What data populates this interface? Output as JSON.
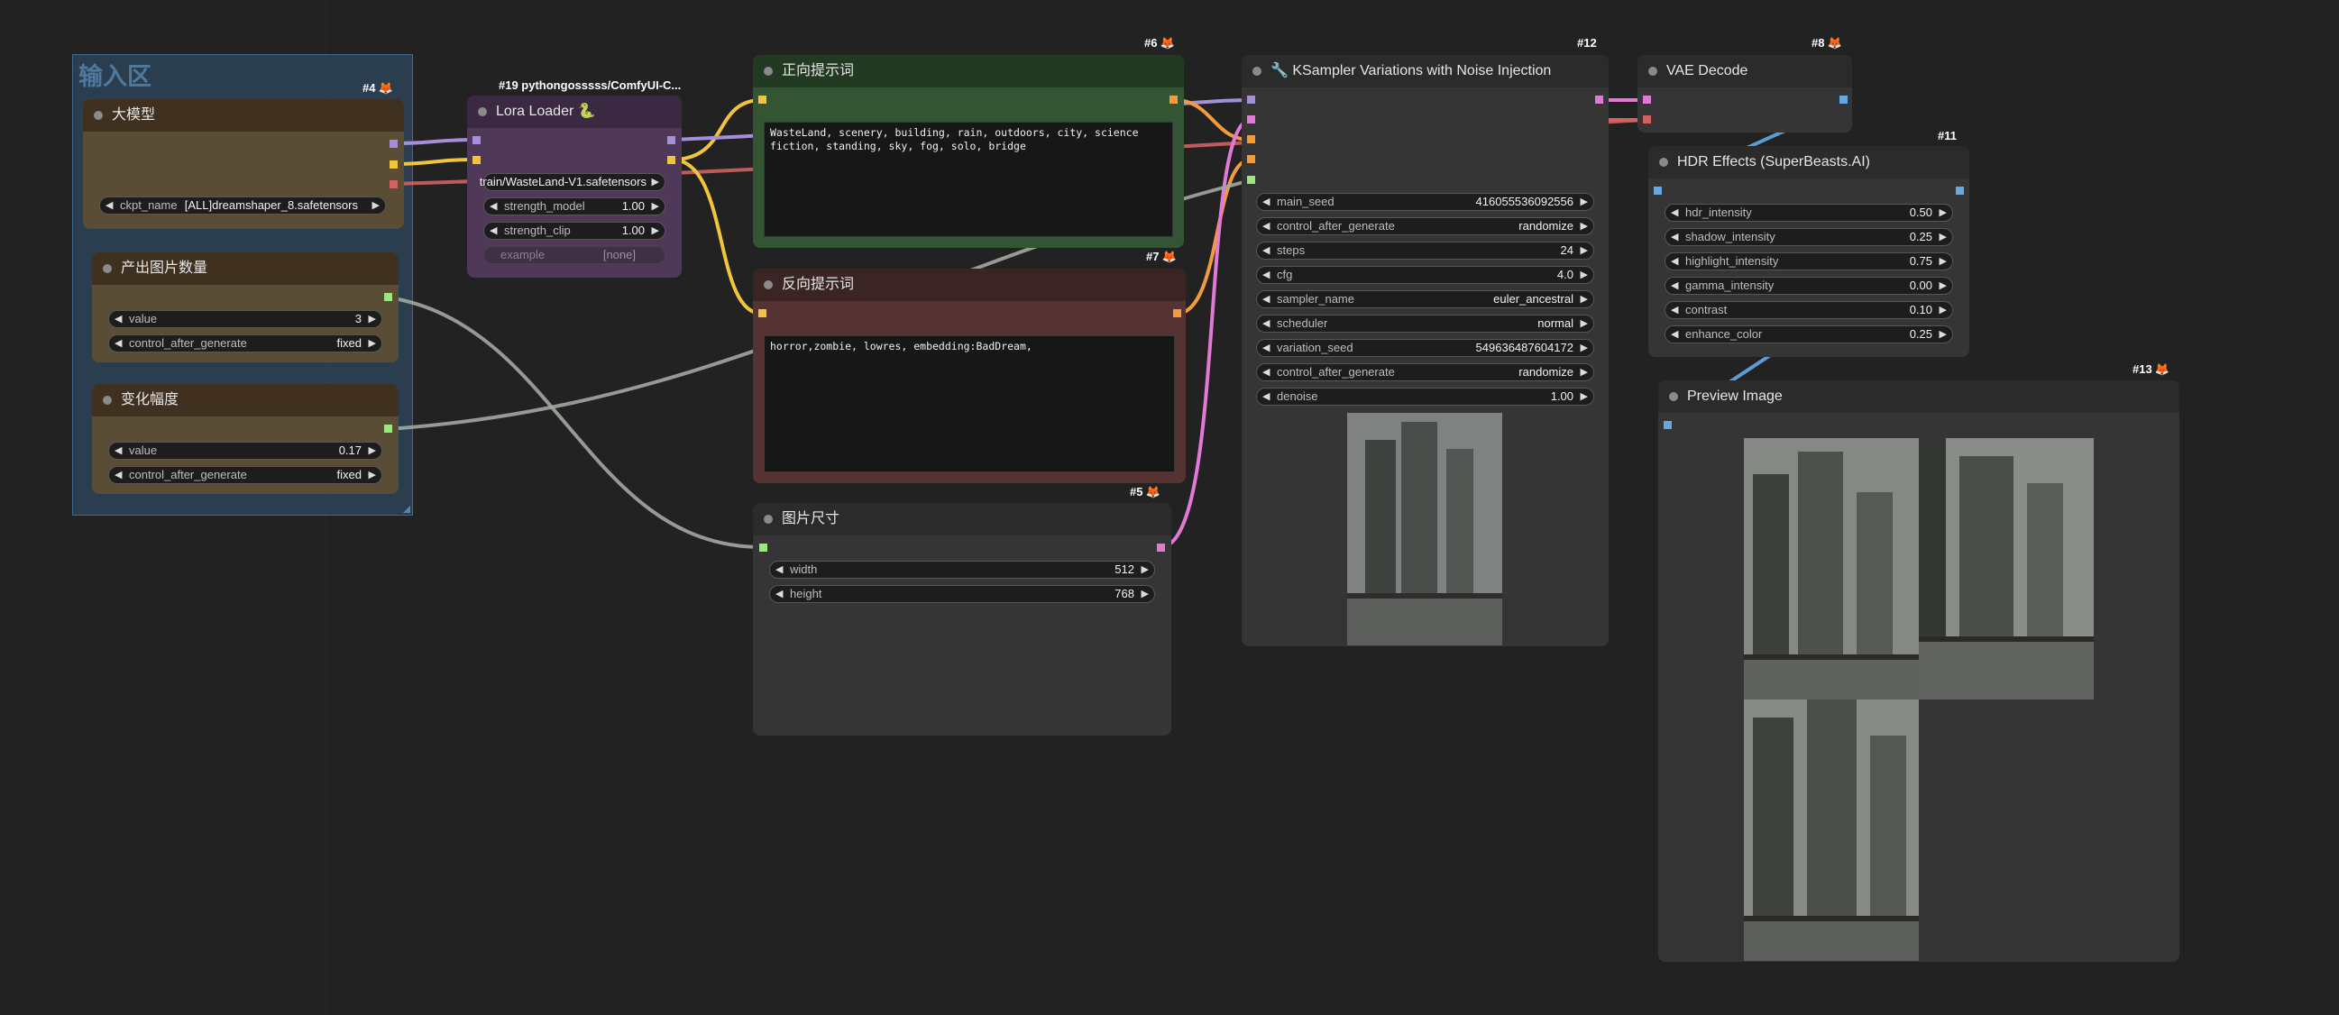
{
  "group": {
    "title": "输入区"
  },
  "colors": {
    "model_purple": "#a58fd8",
    "clip_yellow": "#f0c43c",
    "vae_red": "#d26262",
    "latent_pink": "#e07ad4",
    "image_blue": "#64a8e8",
    "int_green": "#9ae87a",
    "float_gray": "#a0a8a0"
  },
  "nodes": {
    "checkpoint": {
      "badge_id": "#4",
      "title": "大模型",
      "ckpt_label": "ckpt_name",
      "ckpt_value": "[ALL]dreamshaper_8.safetensors"
    },
    "lora": {
      "badge_text": "#19 pythongosssss/ComfyUI-C...",
      "title": "Lora Loader 🐍",
      "lora_name": "train/WasteLand-V1.safetensors",
      "strength_model_label": "strength_model",
      "strength_model_value": "1.00",
      "strength_clip_label": "strength_clip",
      "strength_clip_value": "1.00",
      "example_label": "example",
      "example_value": "[none]"
    },
    "count": {
      "title": "产出图片数量",
      "value_label": "value",
      "value": "3",
      "cag_label": "control_after_generate",
      "cag_value": "fixed"
    },
    "variation": {
      "title": "变化幅度",
      "value_label": "value",
      "value": "0.17",
      "cag_label": "control_after_generate",
      "cag_value": "fixed"
    },
    "positive": {
      "badge_id": "#6",
      "title": "正向提示词",
      "text": "WasteLand, scenery, building, rain, outdoors, city, science fiction, standing, sky, fog, solo, bridge"
    },
    "negative": {
      "badge_id": "#7",
      "title": "反向提示词",
      "text": "horror,zombie, lowres, embedding:BadDream,"
    },
    "size": {
      "badge_id": "#5",
      "title": "图片尺寸",
      "width_label": "width",
      "width_value": "512",
      "height_label": "height",
      "height_value": "768"
    },
    "ksampler": {
      "badge_id": "#12",
      "title": "🔧 KSampler Variations with Noise Injection",
      "widgets": [
        {
          "label": "main_seed",
          "value": "416055536092556"
        },
        {
          "label": "control_after_generate",
          "value": "randomize"
        },
        {
          "label": "steps",
          "value": "24"
        },
        {
          "label": "cfg",
          "value": "4.0"
        },
        {
          "label": "sampler_name",
          "value": "euler_ancestral"
        },
        {
          "label": "scheduler",
          "value": "normal"
        },
        {
          "label": "variation_seed",
          "value": "549636487604172"
        },
        {
          "label": "control_after_generate",
          "value": "randomize"
        },
        {
          "label": "denoise",
          "value": "1.00"
        }
      ]
    },
    "vae": {
      "badge_id": "#8",
      "title": "VAE Decode"
    },
    "hdr": {
      "badge_id": "#11",
      "title": "HDR Effects (SuperBeasts.AI)",
      "widgets": [
        {
          "label": "hdr_intensity",
          "value": "0.50"
        },
        {
          "label": "shadow_intensity",
          "value": "0.25"
        },
        {
          "label": "highlight_intensity",
          "value": "0.75"
        },
        {
          "label": "gamma_intensity",
          "value": "0.00"
        },
        {
          "label": "contrast",
          "value": "0.10"
        },
        {
          "label": "enhance_color",
          "value": "0.25"
        }
      ]
    },
    "preview": {
      "badge_id": "#13",
      "title": "Preview Image"
    }
  },
  "icons": {
    "fox": "fox-icon",
    "arrow_left": "◀",
    "arrow_right": "▶"
  }
}
